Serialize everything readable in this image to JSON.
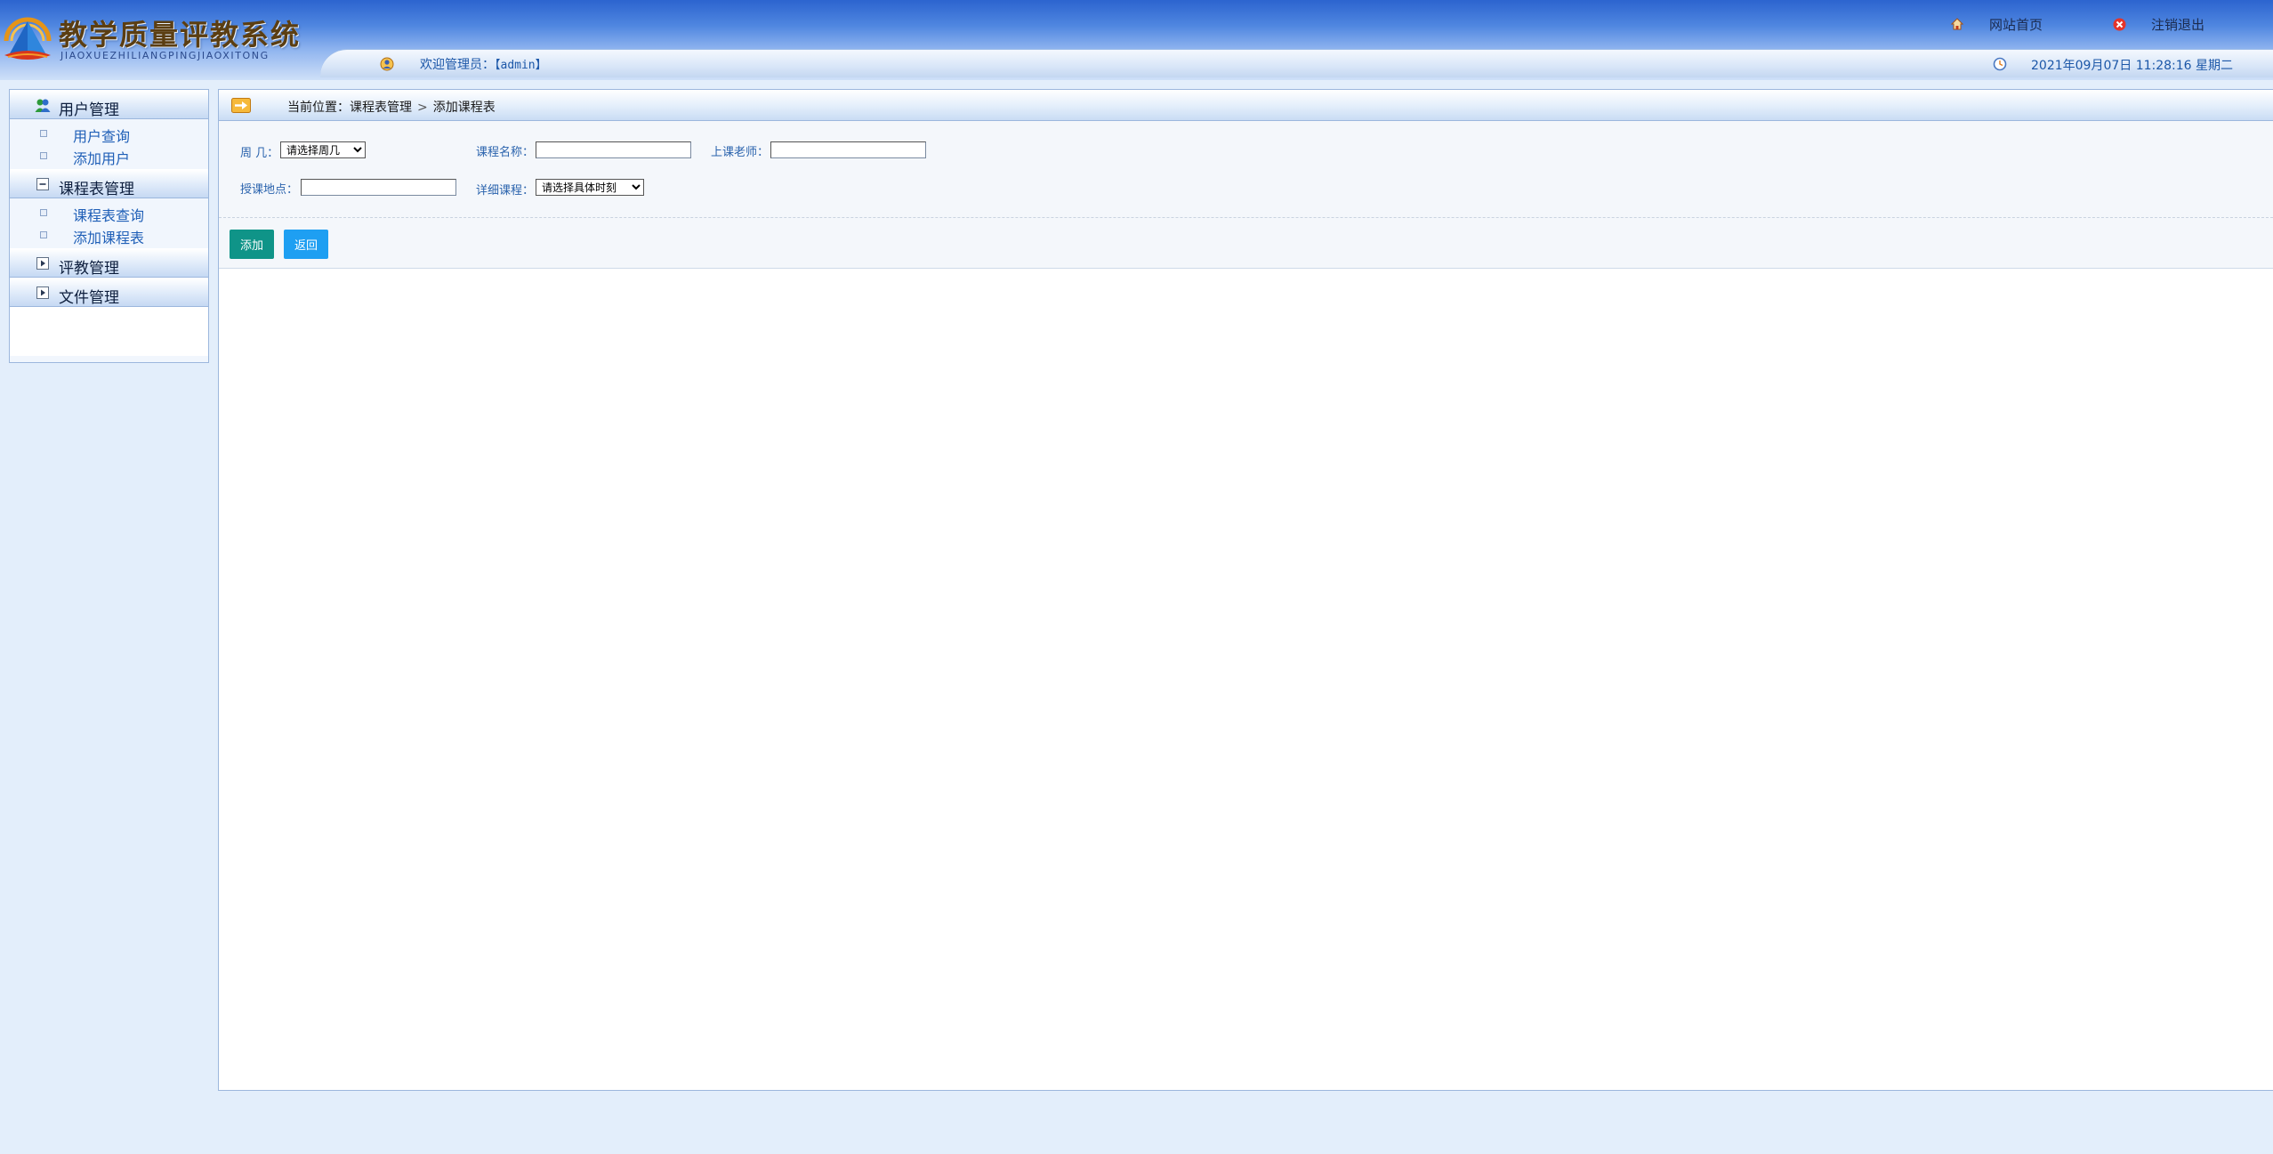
{
  "header": {
    "title": "教学质量评教系统",
    "subtitle": "JIAOXUEZHILIANGPINGJIAOXITONG",
    "home_link": "网站首页",
    "logout_link": "注销退出",
    "welcome_prefix": "欢迎管理员：",
    "welcome_user": "【admin】",
    "datetime": "2021年09月07日 11:28:16 星期二"
  },
  "sidebar": {
    "groups": [
      {
        "label": "用户管理",
        "items": [
          "用户查询",
          "添加用户"
        ]
      },
      {
        "label": "课程表管理",
        "items": [
          "课程表查询",
          "添加课程表"
        ]
      },
      {
        "label": "评教管理",
        "items": []
      },
      {
        "label": "文件管理",
        "items": []
      }
    ]
  },
  "breadcrumb": {
    "prefix": "当前位置：",
    "section": "课程表管理",
    "separator": ">",
    "page": "添加课程表"
  },
  "form": {
    "weekday_label": "周 几：",
    "weekday_value": "请选择周几",
    "course_name_label": "课程名称：",
    "course_name_value": "",
    "teacher_label": "上课老师：",
    "teacher_value": "",
    "location_label": "授课地点：",
    "location_value": "",
    "detail_label": "详细课程：",
    "detail_value": "请选择具体时刻",
    "add_button": "添加",
    "back_button": "返回"
  },
  "colors": {
    "accent_blue": "#1c57a8",
    "add_button": "#0f9488",
    "back_button": "#1e9ff2"
  }
}
